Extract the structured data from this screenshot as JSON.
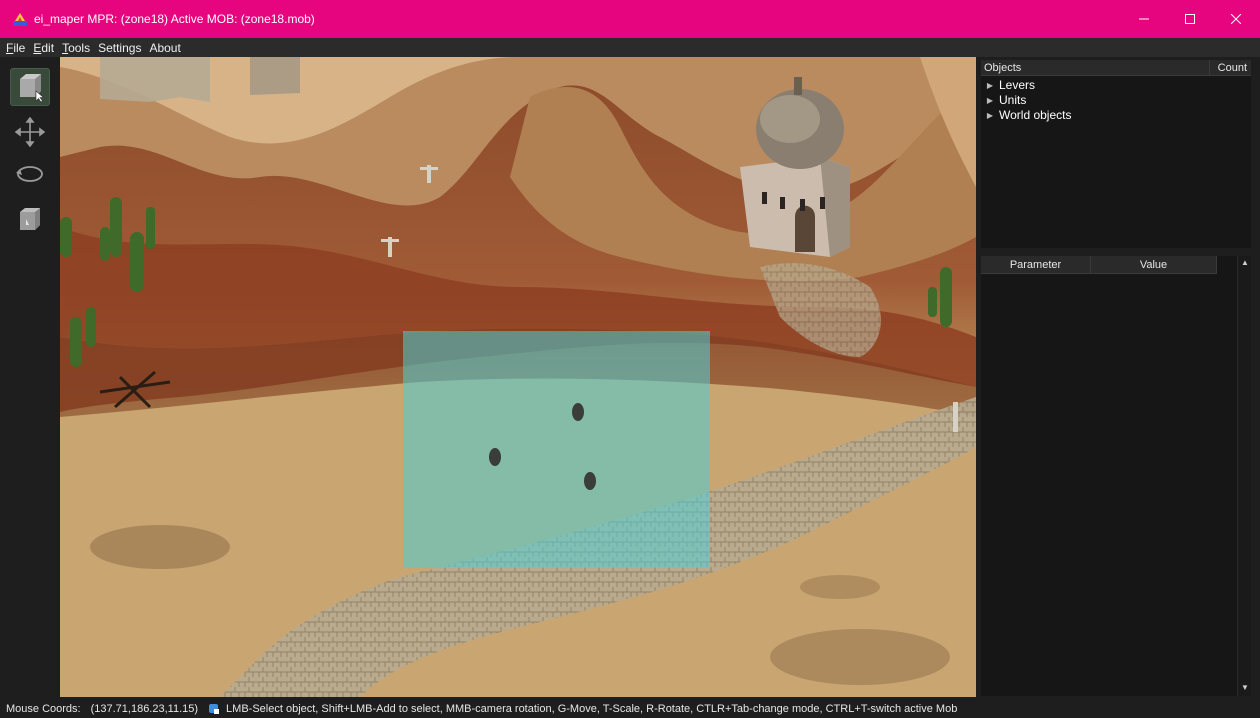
{
  "window": {
    "title": "ei_maper MPR: (zone18) Active MOB: (zone18.mob)",
    "accent": "#e6057e"
  },
  "menu": [
    {
      "label": "File",
      "mnemonic": "F",
      "rest": "ile"
    },
    {
      "label": "Edit",
      "mnemonic": "E",
      "rest": "dit"
    },
    {
      "label": "Tools",
      "mnemonic": "T",
      "rest": "ools"
    },
    {
      "label": "Settings",
      "mnemonic": "",
      "rest": "Settings"
    },
    {
      "label": "About",
      "mnemonic": "",
      "rest": "About"
    }
  ],
  "toolbar": {
    "tools": [
      "select-tool",
      "move-tool",
      "rotate-tool",
      "scale-tool"
    ],
    "active": "select-tool"
  },
  "objects_panel": {
    "col_name": "Objects",
    "col_count": "Count",
    "items": [
      "Levers",
      "Units",
      "World objects"
    ]
  },
  "params_panel": {
    "col_param": "Parameter",
    "col_value": "Value"
  },
  "status": {
    "mouse_label": "Mouse Coords:",
    "mouse_coords": "(137.71,186.23,11.15)",
    "hint": "LMB-Select object, Shift+LMB-Add to select, MMB-camera rotation, G-Move, T-Scale, R-Rotate, CTLR+Tab-change mode, CTRL+T-switch active Mob"
  }
}
